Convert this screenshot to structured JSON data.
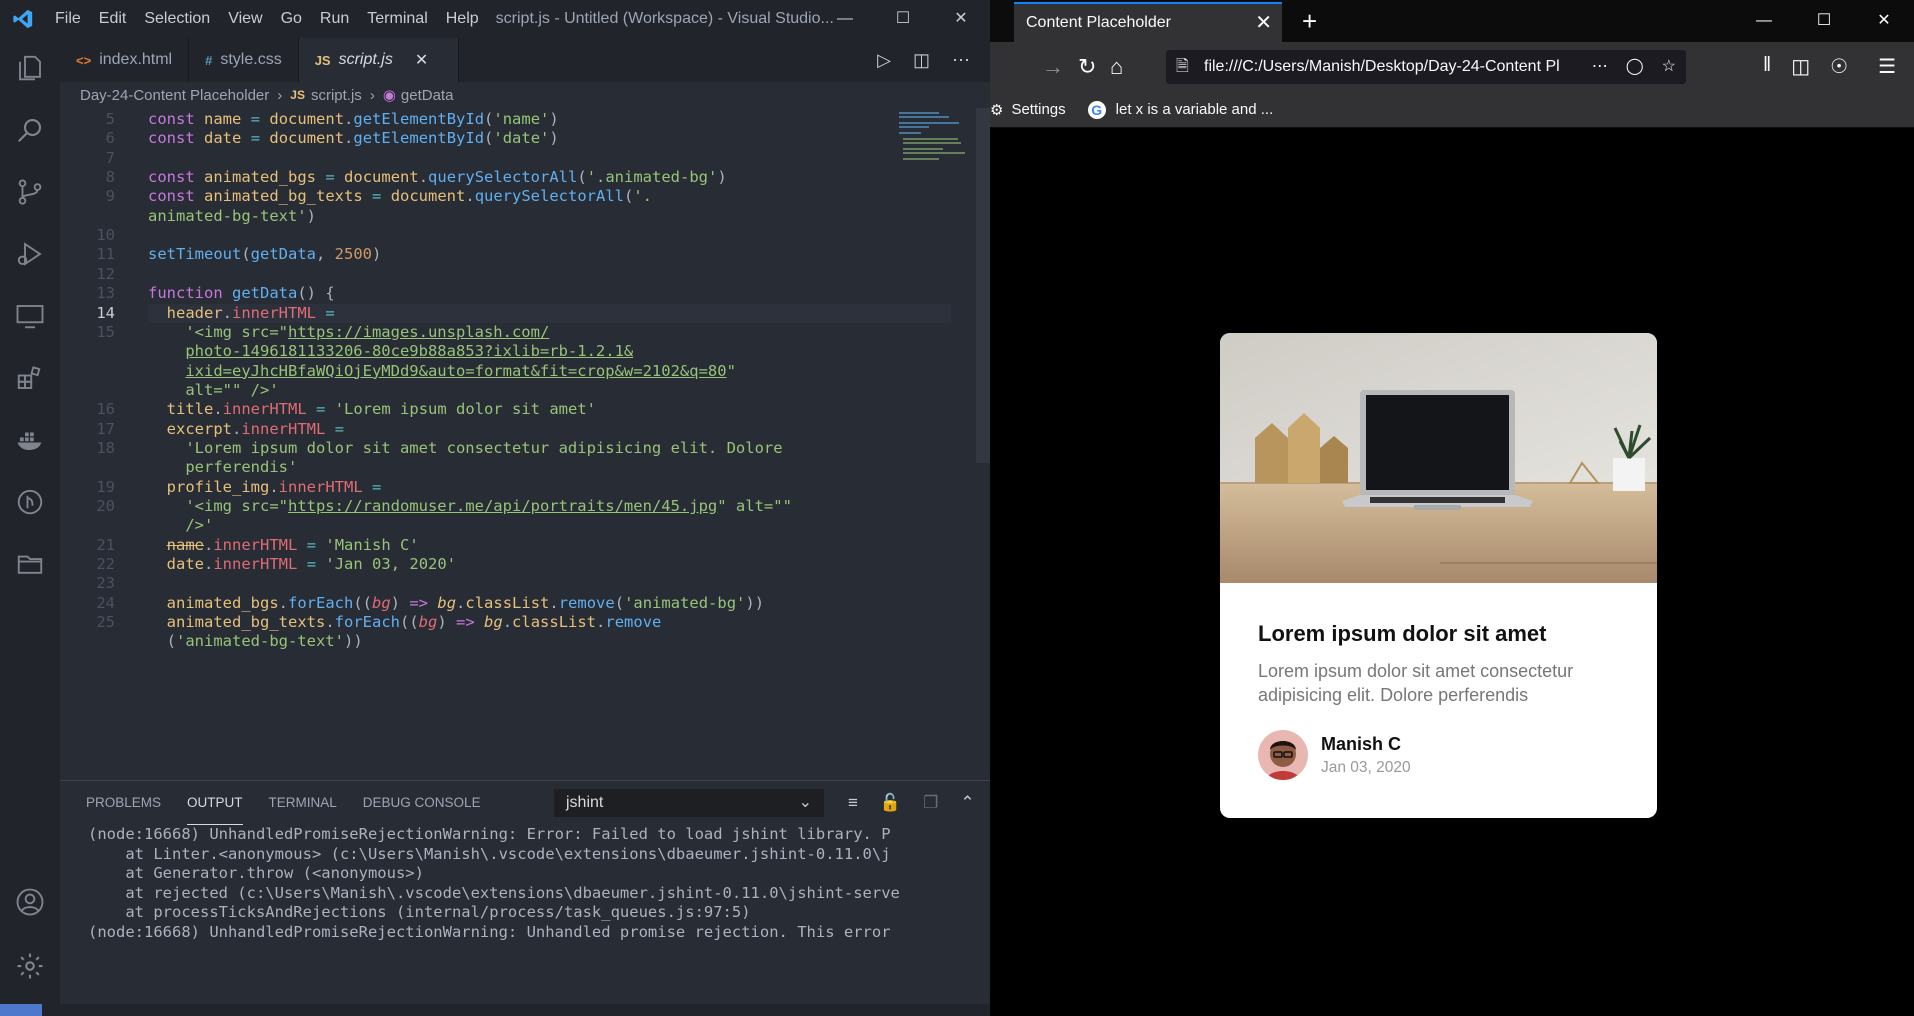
{
  "vscode": {
    "menu": [
      "File",
      "Edit",
      "Selection",
      "View",
      "Go",
      "Run",
      "Terminal",
      "Help"
    ],
    "window_title": "script.js - Untitled (Workspace) - Visual Studio...",
    "tabs": [
      {
        "icon": "<>",
        "label": "index.html"
      },
      {
        "icon": "#",
        "label": "style.css"
      },
      {
        "icon": "JS",
        "label": "script.js"
      }
    ],
    "breadcrumb": {
      "folder": "Day-24-Content Placeholder",
      "file": "script.js",
      "symbol": "getData"
    },
    "panel": {
      "tabs": [
        "PROBLEMS",
        "OUTPUT",
        "TERMINAL",
        "DEBUG CONSOLE"
      ],
      "selected_channel": "jshint",
      "output_lines": [
        "(node:16668) UnhandledPromiseRejectionWarning: Error: Failed to load jshint library. P",
        "    at Linter.<anonymous> (c:\\Users\\Manish\\.vscode\\extensions\\dbaeumer.jshint-0.11.0\\j",
        "    at Generator.throw (<anonymous>)",
        "    at rejected (c:\\Users\\Manish\\.vscode\\extensions\\dbaeumer.jshint-0.11.0\\jshint-serve",
        "    at processTicksAndRejections (internal/process/task_queues.js:97:5)",
        "(node:16668) UnhandledPromiseRejectionWarning: Unhandled promise rejection. This error"
      ]
    },
    "code_lines": [
      {
        "n": "5",
        "html": "<span class='kw'>const</span> <span class='var'>name</span> <span class='op'>=</span> <span class='var'>document</span>.<span class='fn'>getElementById</span>(<span class='str'>'name'</span>)"
      },
      {
        "n": "6",
        "html": "<span class='kw'>const</span> <span class='var'>date</span> <span class='op'>=</span> <span class='var'>document</span>.<span class='fn'>getElementById</span>(<span class='str'>'date'</span>)"
      },
      {
        "n": "7",
        "html": ""
      },
      {
        "n": "8",
        "html": "<span class='kw'>const</span> <span class='var'>animated_bgs</span> <span class='op'>=</span> <span class='var'>document</span>.<span class='fn'>querySelectorAll</span>(<span class='str'>'.animated-bg'</span>)"
      },
      {
        "n": "9",
        "html": "<span class='kw'>const</span> <span class='var'>animated_bg_texts</span> <span class='op'>=</span> <span class='var'>document</span>.<span class='fn'>querySelectorAll</span>(<span class='str'>'.</span>"
      },
      {
        "n": "",
        "html": "<span class='str'>animated-bg-text'</span>)"
      },
      {
        "n": "10",
        "html": ""
      },
      {
        "n": "11",
        "html": "<span class='fn'>setTimeout</span>(<span class='fn'>getData</span>, <span class='num'>2500</span>)"
      },
      {
        "n": "12",
        "html": ""
      },
      {
        "n": "13",
        "html": "<span class='kw'>function</span> <span class='fn'>getData</span>() {"
      },
      {
        "n": "14",
        "html": "  <span class='var'>header</span>.<span class='prop'>innerHTML</span> <span class='op'>=</span>"
      },
      {
        "n": "15",
        "html": "    <span class='str'>'&lt;img src=\"<span class='url'>https://images.unsplash.com/</span></span>"
      },
      {
        "n": "",
        "html": "    <span class='str'><span class='url'>photo-1496181133206-80ce9b88a853?ixlib=rb-1.2.1&amp;</span></span>"
      },
      {
        "n": "",
        "html": "    <span class='str'><span class='url'>ixid=eyJhcHBfaWQiOjEyMDd9&amp;auto=format&amp;fit=crop&amp;w=2102&amp;q=80</span>\"</span>"
      },
      {
        "n": "",
        "html": "    <span class='str'>alt=\"\" /&gt;'</span>"
      },
      {
        "n": "16",
        "html": "  <span class='var'>title</span>.<span class='prop'>innerHTML</span> <span class='op'>=</span> <span class='str'>'Lorem ipsum dolor sit amet'</span>"
      },
      {
        "n": "17",
        "html": "  <span class='var'>excerpt</span>.<span class='prop'>innerHTML</span> <span class='op'>=</span>"
      },
      {
        "n": "18",
        "html": "    <span class='str'>'Lorem ipsum dolor sit amet consectetur adipisicing elit. Dolore</span>"
      },
      {
        "n": "",
        "html": "    <span class='str'>perferendis'</span>"
      },
      {
        "n": "19",
        "html": "  <span class='var'>profile_img</span>.<span class='prop'>innerHTML</span> <span class='op'>=</span>"
      },
      {
        "n": "20",
        "html": "    <span class='str'>'&lt;img src=\"<span class='url'>https://randomuser.me/api/portraits/men/45.jpg</span>\" alt=\"\"</span>"
      },
      {
        "n": "",
        "html": "    <span class='str'>/&gt;'</span>"
      },
      {
        "n": "21",
        "html": "  <span class='var' style='text-decoration:line-through'>name</span>.<span class='prop'>innerHTML</span> <span class='op'>=</span> <span class='str'>'Manish C'</span>"
      },
      {
        "n": "22",
        "html": "  <span class='var'>date</span>.<span class='prop'>innerHTML</span> <span class='op'>=</span> <span class='str'>'Jan 03, 2020'</span>"
      },
      {
        "n": "23",
        "html": ""
      },
      {
        "n": "24",
        "html": "  <span class='var'>animated_bgs</span>.<span class='fn'>forEach</span>((<span class='prop' style='font-style:italic'>bg</span>) <span class='kw'>=&gt;</span> <span class='var' style='font-style:italic'>bg</span>.<span class='var'>classList</span>.<span class='fn'>remove</span>(<span class='str'>'animated-bg'</span>))"
      },
      {
        "n": "25",
        "html": "  <span class='var'>animated_bg_texts</span>.<span class='fn'>forEach</span>((<span class='prop' style='font-style:italic'>bg</span>) <span class='kw'>=&gt;</span> <span class='var' style='font-style:italic'>bg</span>.<span class='var'>classList</span>.<span class='fn'>remove</span>"
      },
      {
        "n": "",
        "html": "  (<span class='str'>'animated-bg-text'</span>))"
      }
    ]
  },
  "firefox": {
    "tab_title": "Content Placeholder",
    "url": "file:///C:/Users/Manish/Desktop/Day-24-Content Pl",
    "bookmarks": [
      {
        "label": "Settings"
      },
      {
        "label": "let x is a variable and ..."
      }
    ]
  },
  "card": {
    "title": "Lorem ipsum dolor sit amet",
    "excerpt": "Lorem ipsum dolor sit amet consectetur adipisicing elit. Dolore perferendis",
    "author_name": "Manish C",
    "author_date": "Jan 03, 2020"
  }
}
